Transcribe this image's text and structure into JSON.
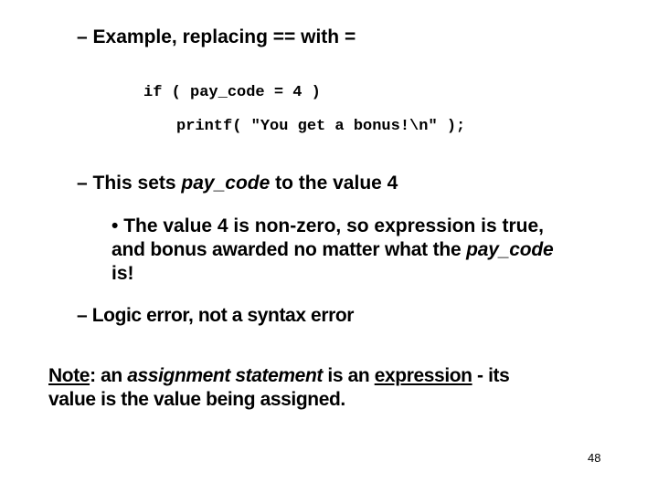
{
  "slide": {
    "example_heading": {
      "dash": "–",
      "text": "Example, replacing == with ="
    },
    "code": {
      "line1": "if ( pay_code = 4 )",
      "line2": "printf( \"You get a bonus!\\n\" );"
    },
    "sets_point": {
      "dash": "–",
      "before": "This sets ",
      "italic": "pay_code",
      "after": " to the value 4"
    },
    "bullet": {
      "marker": "•",
      "line1": "The value 4 is non-zero, so expression is true,",
      "line2_before": "and bonus awarded no matter what the ",
      "line2_italic": "pay_code",
      "line3": "is!"
    },
    "logic_point": {
      "dash": "–",
      "text": "Logic error, not a syntax error"
    },
    "note": {
      "label": "Note",
      "colon": ": an ",
      "italic": "assignment statement",
      "middle": " is an ",
      "underlined": "expression",
      "after": " - its",
      "line2": "value is the value being assigned."
    },
    "page_number": "48"
  }
}
